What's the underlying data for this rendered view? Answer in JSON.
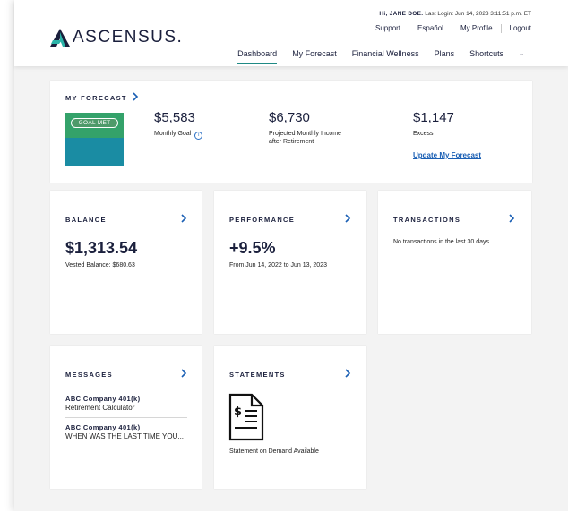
{
  "header": {
    "brand": "ASCENSUS.",
    "greeting_name": "Hi, JANE DOE.",
    "last_login": "Last Login: Jun 14, 2023 3:11:51 p.m. ET",
    "util_links": [
      "Support",
      "Español",
      "My Profile",
      "Logout"
    ],
    "nav": [
      "Dashboard",
      "My Forecast",
      "Financial Wellness",
      "Plans",
      "Shortcuts"
    ],
    "active_nav": "Dashboard"
  },
  "forecast": {
    "title": "MY FORECAST",
    "badge": "GOAL MET",
    "monthly_goal_value": "$5,583",
    "monthly_goal_label": "Monthly Goal",
    "projected_value": "$6,730",
    "projected_label_line1": "Projected Monthly Income",
    "projected_label_line2": "after Retirement",
    "excess_value": "$1,147",
    "excess_label": "Excess",
    "update_link": "Update My Forecast"
  },
  "balance": {
    "title": "BALANCE",
    "value": "$1,313.54",
    "sub": "Vested Balance: $680.63"
  },
  "performance": {
    "title": "PERFORMANCE",
    "value": "+9.5%",
    "sub": "From Jun 14, 2022 to Jun 13, 2023"
  },
  "transactions": {
    "title": "TRANSACTIONS",
    "message": "No transactions in the last 30 days"
  },
  "messages": {
    "title": "MESSAGES",
    "items": [
      {
        "company": "ABC Company 401(k)",
        "subject": "Retirement Calculator"
      },
      {
        "company": "ABC Company 401(k)",
        "subject": "WHEN WAS THE LAST TIME YOU..."
      }
    ]
  },
  "statements": {
    "title": "STATEMENTS",
    "caption": "Statement on Demand Available"
  },
  "colors": {
    "navy": "#1a1f3c",
    "teal_accent": "#1f8a85",
    "link_blue": "#1a5fb4",
    "goal_green": "#34a26a",
    "goal_blue": "#1a8ca3"
  },
  "icons": [
    "ascensus-logo",
    "info-icon",
    "chevron-right-icon",
    "chevron-down-icon",
    "statement-document-icon"
  ]
}
